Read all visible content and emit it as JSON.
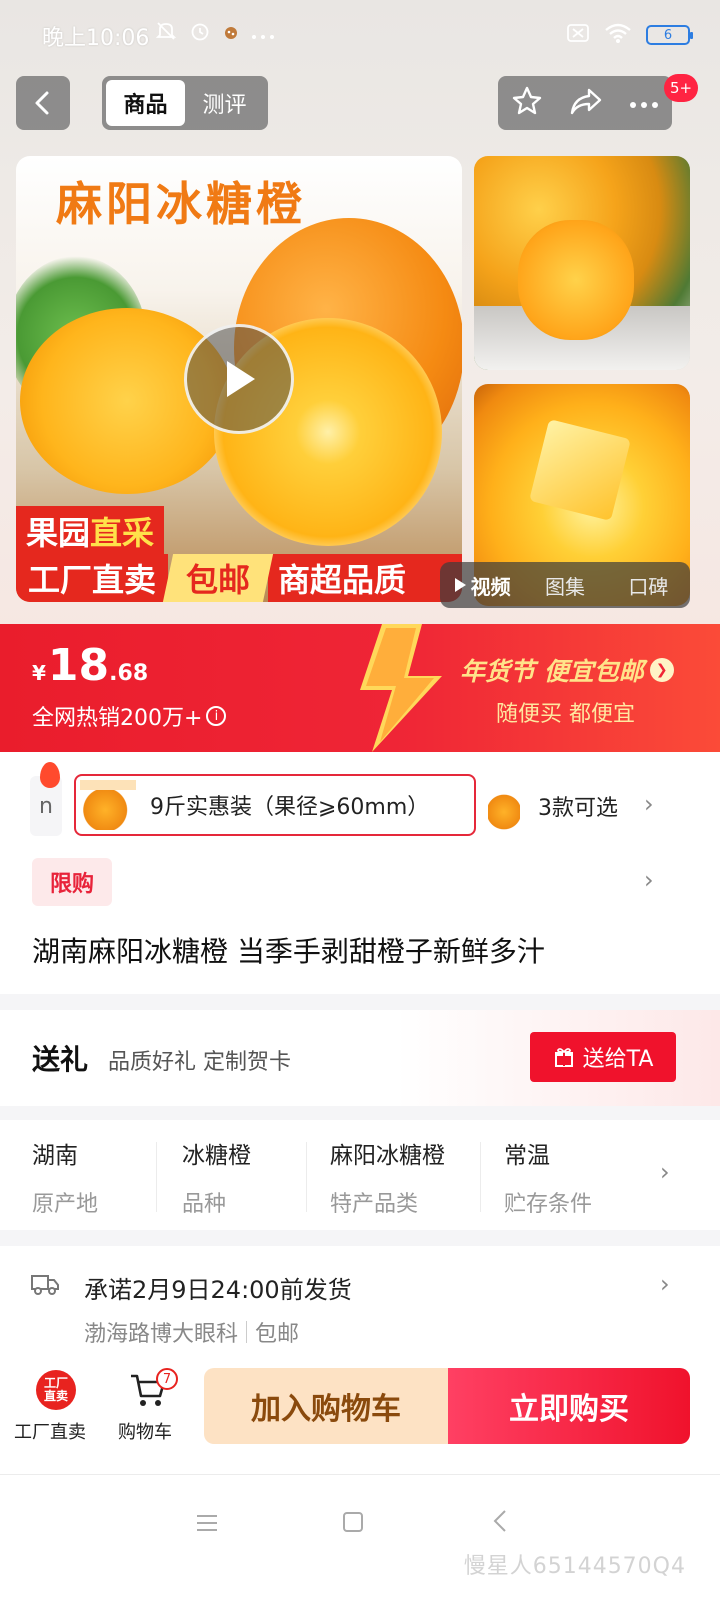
{
  "status_bar": {
    "time": "晚上10:06",
    "battery": "6"
  },
  "nav": {
    "tabs": [
      {
        "label": "商品",
        "active": true
      },
      {
        "label": "测评",
        "active": false
      }
    ],
    "message_badge": "5+"
  },
  "gallery": {
    "main_image": {
      "title": "麻阳冰糖橙",
      "promo_line1_a": "果园",
      "promo_line1_b": "直采",
      "promo_a": "工厂直卖",
      "promo_b": "包邮",
      "promo_c": "商超品质"
    },
    "media_tabs": [
      "视频",
      "图集",
      "口碑"
    ]
  },
  "price": {
    "currency": "¥",
    "integer": "18",
    "decimal": ".68",
    "sales": "全网热销200万+",
    "info_icon": "i",
    "promo_title": "年货节 便宜包邮",
    "promo_sub": "随便买 都便宜"
  },
  "sku": {
    "edge_label": "n",
    "selected": "9斤实惠装（果径⩾60mm）",
    "more": "3款可选"
  },
  "limit_badge": "限购",
  "product_title": "湖南麻阳冰糖橙 当季手剥甜橙子新鲜多汁",
  "gift": {
    "title": "送礼",
    "subtitle": "品质好礼 定制贺卡",
    "button": "送给TA"
  },
  "attributes": [
    {
      "value": "湖南",
      "key": "原产地"
    },
    {
      "value": "冰糖橙",
      "key": "品种"
    },
    {
      "value": "麻阳冰糖橙",
      "key": "特产品类"
    },
    {
      "value": "常温",
      "key": "贮存条件"
    }
  ],
  "delivery": {
    "promise": "承诺2月9日24:00前发货",
    "location": "渤海路博大眼科",
    "shipping": "包邮"
  },
  "action_bar": {
    "shop_icon_text": "工厂直卖",
    "shop_label": "工厂直卖",
    "cart_label": "购物车",
    "cart_count": "7",
    "add_to_cart": "加入购物车",
    "buy_now": "立即购买"
  },
  "watermark": "慢星人65144570Q4",
  "icons": {
    "back": "back-arrow-icon",
    "favorite": "star-icon",
    "share": "share-icon",
    "more": "more-dots-icon",
    "play": "play-icon",
    "gift": "gift-icon",
    "truck": "truck-icon",
    "cart": "cart-icon",
    "chevron": "chevron-right-icon"
  },
  "colors": {
    "brand_red": "#ea1d2c",
    "buy_button": "#f0122c",
    "cart_button_bg": "#fde2c4",
    "title_orange": "#f07a14"
  }
}
